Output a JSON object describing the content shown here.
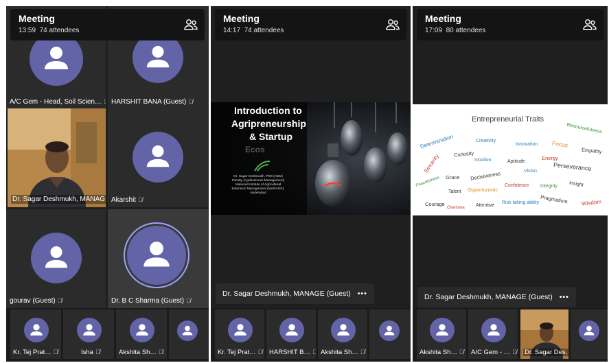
{
  "panel1": {
    "title": "Meeting",
    "time": "13:59",
    "attendees": "74 attendees",
    "tiles": [
      {
        "name": "A/C Gem - Head, Soil Scien…"
      },
      {
        "name": "HARSHIT BANA (Guest)"
      },
      {
        "name": "Dr. Sagar Deshmukh, MANAG…"
      },
      {
        "name": "Akarshit"
      },
      {
        "name": "gourav (Guest)"
      },
      {
        "name": "Dr. B C Sharma (Guest)"
      }
    ],
    "bottom": [
      "Kr. Tej Prat…",
      "Isha",
      "Akshita Sh…"
    ]
  },
  "panel2": {
    "title": "Meeting",
    "time": "14:17",
    "attendees": "74 attendees",
    "slide": {
      "title_line1": "Introduction to",
      "title_line2": "Agripreneurship",
      "title_line3": "& Startup",
      "title_line4": "Ecos",
      "presenter_lines": [
        "Dr. Sagar Deshmukh, PhD (ABM)",
        "Faculty (Agribusiness Management)",
        "National Institute of Agricultural",
        "Extension Management (MANAGE),",
        "Hyderabad"
      ]
    },
    "presenter": "Dr. Sagar Deshmukh, MANAGE (Guest)",
    "more": "•••",
    "bottom": [
      "Kr. Tej Prat…",
      "HARSHIT B…",
      "Akshita Sh…"
    ]
  },
  "panel3": {
    "title": "Meeting",
    "time": "17:09",
    "attendees": "80 attendees",
    "slide": {
      "title": "Entrepreneurial Traits",
      "words": [
        "Resourcefulness",
        "Determination",
        "Creativity",
        "Innovation",
        "Focus",
        "Empathy",
        "Curiosity",
        "Sincerity",
        "Intuition",
        "Aptitude",
        "Energy",
        "Perseverance",
        "Vision",
        "Peacefulness",
        "Grace",
        "Decisiveness",
        "Insight",
        "Opportunistic",
        "Confidence",
        "Integrity",
        "Talent",
        "Pragmatism",
        "Wisdom",
        "Courage",
        "Charisma",
        "Attentive",
        "Risk taking ability"
      ]
    },
    "presenter": "Dr. Sagar Deshmukh, MANAGE (Guest)",
    "more": "•••",
    "bottom": [
      "Akshita Sh…",
      "A/C Gem - …",
      "Dr. Sagar Des…"
    ]
  },
  "colors": {
    "avatar": "#6264a7",
    "tile": "#2b2b2b",
    "bg": "#1f1f1f"
  },
  "icons": [
    "people-icon",
    "mic-off-icon",
    "person-icon",
    "more-icon"
  ]
}
